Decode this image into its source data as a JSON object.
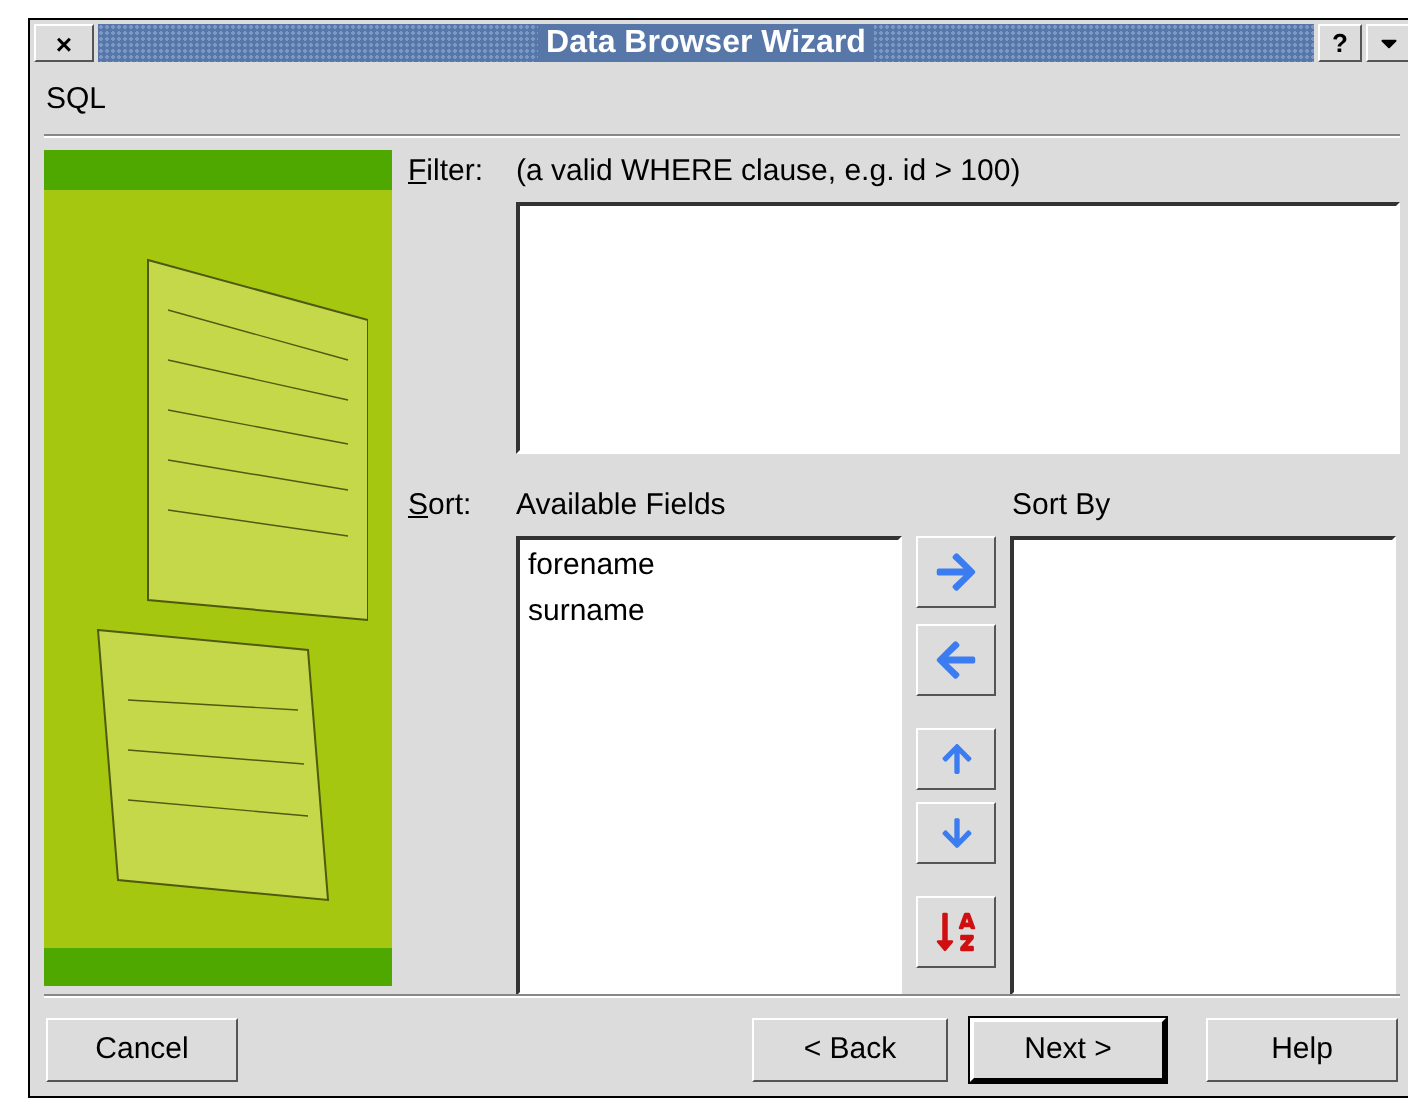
{
  "window": {
    "title": "Data Browser Wizard",
    "close_glyph": "×",
    "help_glyph": "?"
  },
  "page_title": "SQL",
  "filter": {
    "label": "Filter:",
    "hint": "(a valid WHERE clause, e.g. id > 100)"
  },
  "sort": {
    "label": "Sort:",
    "available_title": "Available Fields",
    "sort_by_title": "Sort By",
    "available_fields": [
      {
        "name": "forename",
        "selected": false
      },
      {
        "name": "surname",
        "selected": false
      }
    ]
  },
  "buttons": [
    {
      "label": "Cancel",
      "kind": "cancel",
      "default": false
    },
    {
      "label": "< Back",
      "kind": "nav",
      "default": false
    },
    {
      "label": "Next >",
      "kind": "nav",
      "default": true
    },
    {
      "label": "Help",
      "kind": "help",
      "default": false
    }
  ]
}
